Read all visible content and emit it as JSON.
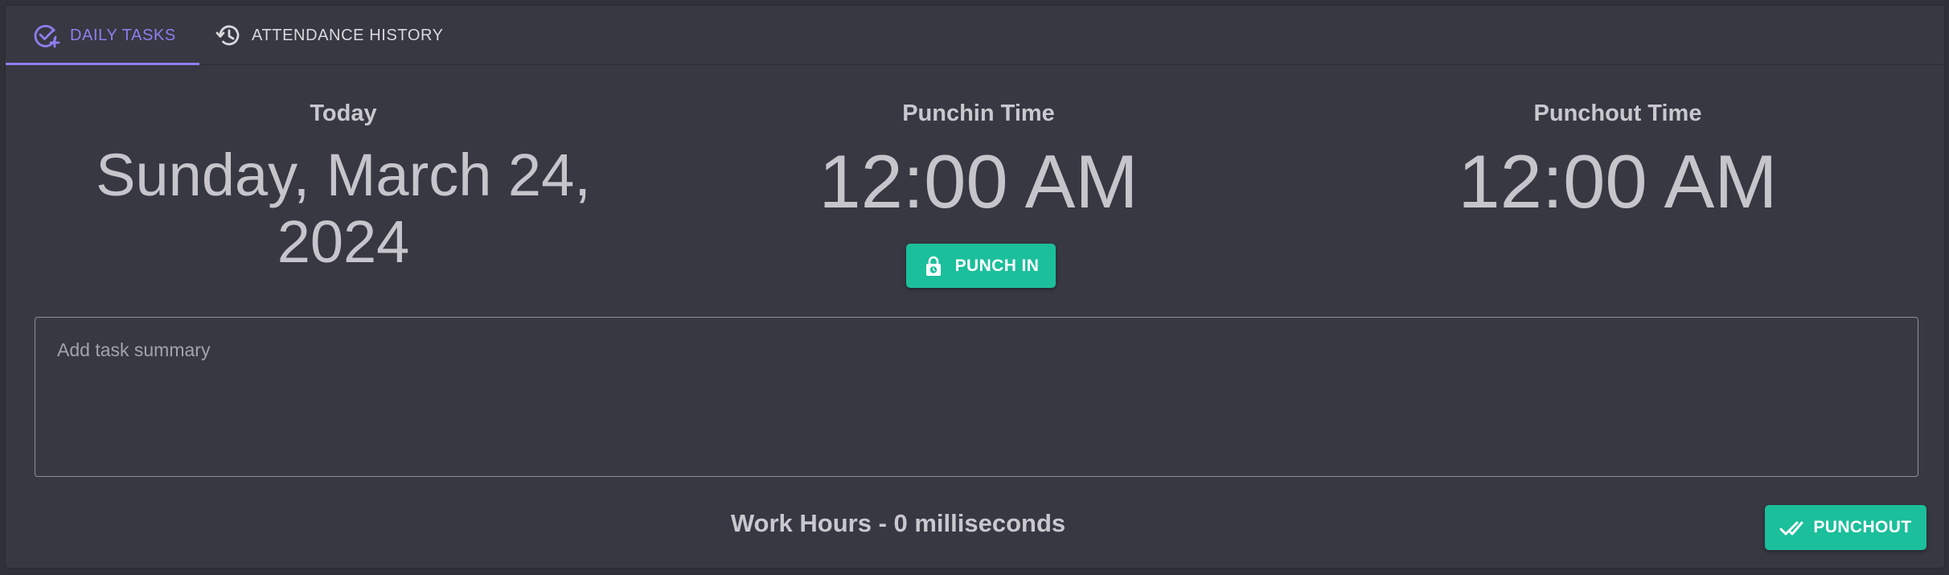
{
  "tabs": [
    {
      "label": "DAILY TASKS",
      "icon": "check-circle-plus-icon",
      "active": true
    },
    {
      "label": "ATTENDANCE HISTORY",
      "icon": "history-icon",
      "active": false
    }
  ],
  "today": {
    "label": "Today",
    "date_line1": "Sunday, March 24,",
    "date_line2": "2024"
  },
  "punchin": {
    "label": "Punchin Time",
    "time": "12:00 AM",
    "button_label": "PUNCH IN",
    "button_icon": "lock-clock-icon"
  },
  "punchout": {
    "label": "Punchout Time",
    "time": "12:00 AM"
  },
  "summary": {
    "placeholder": "Add task summary",
    "value": ""
  },
  "footer": {
    "work_hours": "Work Hours - 0 milliseconds",
    "punchout_label": "PUNCHOUT",
    "punchout_icon": "double-check-icon"
  },
  "colors": {
    "accent": "#8c7ff0",
    "button": "#1bbf9b",
    "background": "#373841"
  }
}
